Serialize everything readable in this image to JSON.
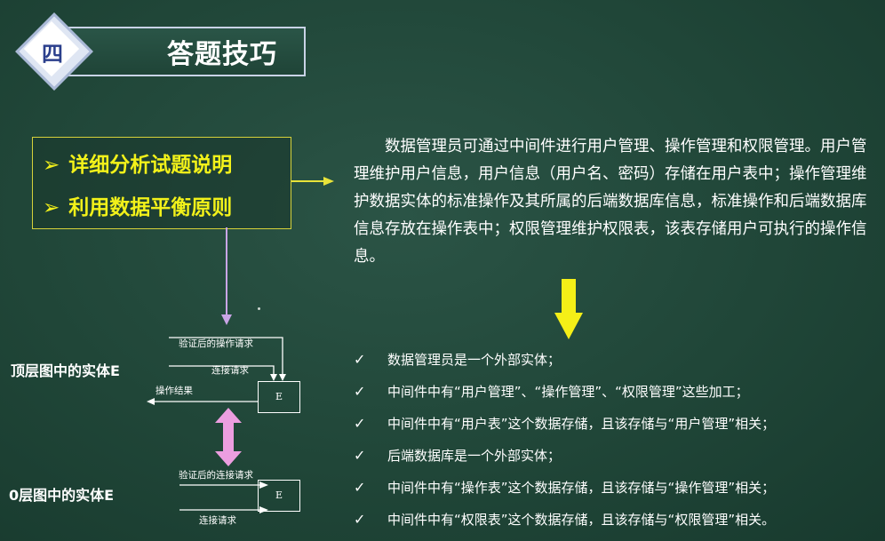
{
  "header": {
    "section_number": "四",
    "title": "答题技巧"
  },
  "tips": [
    "详细分析试题说明",
    "利用数据平衡原则"
  ],
  "description": "数据管理员可通过中间件进行用户管理、操作管理和权限管理。用户管理维护用户信息，用户信息（用户名、密码）存储在用户表中；操作管理维护数据实体的标准操作及其所属的后端数据库信息，标准操作和后端数据库信息存放在操作表中；权限管理维护权限表，该表存储用户可执行的操作信息。",
  "conclusions": [
    "数据管理员是一个外部实体；",
    "中间件中有“用户管理”、“操作管理”、“权限管理”这些加工；",
    "中间件中有“用户表”这个数据存储，且该存储与“用户管理”相关；",
    "后端数据库是一个外部实体；",
    "中间件中有“操作表”这个数据存储，且该存储与“操作管理”相关；",
    "中间件中有“权限表”这个数据存储，且该存储与“权限管理”相关。"
  ],
  "check_mark": "✓",
  "top_diagram": {
    "label": "顶层图中的实体E",
    "entity": "E",
    "flow_1": "验证后的操作请求",
    "flow_2": "连接请求",
    "flow_3": "操作结果"
  },
  "level0_diagram": {
    "label": "0层图中的实体E",
    "entity": "E",
    "flow_1": "验证后的连接请求",
    "flow_2": "连接请求"
  },
  "colors": {
    "background": "#204638",
    "tip_text": "#f2f11a",
    "tip_border": "#d6d13a",
    "yellow_arrow": "#f5ef17",
    "lilac_arrow": "#c9a5e6",
    "pink_arrow": "#ec9ee0",
    "title_number": "#2b3f8c"
  }
}
